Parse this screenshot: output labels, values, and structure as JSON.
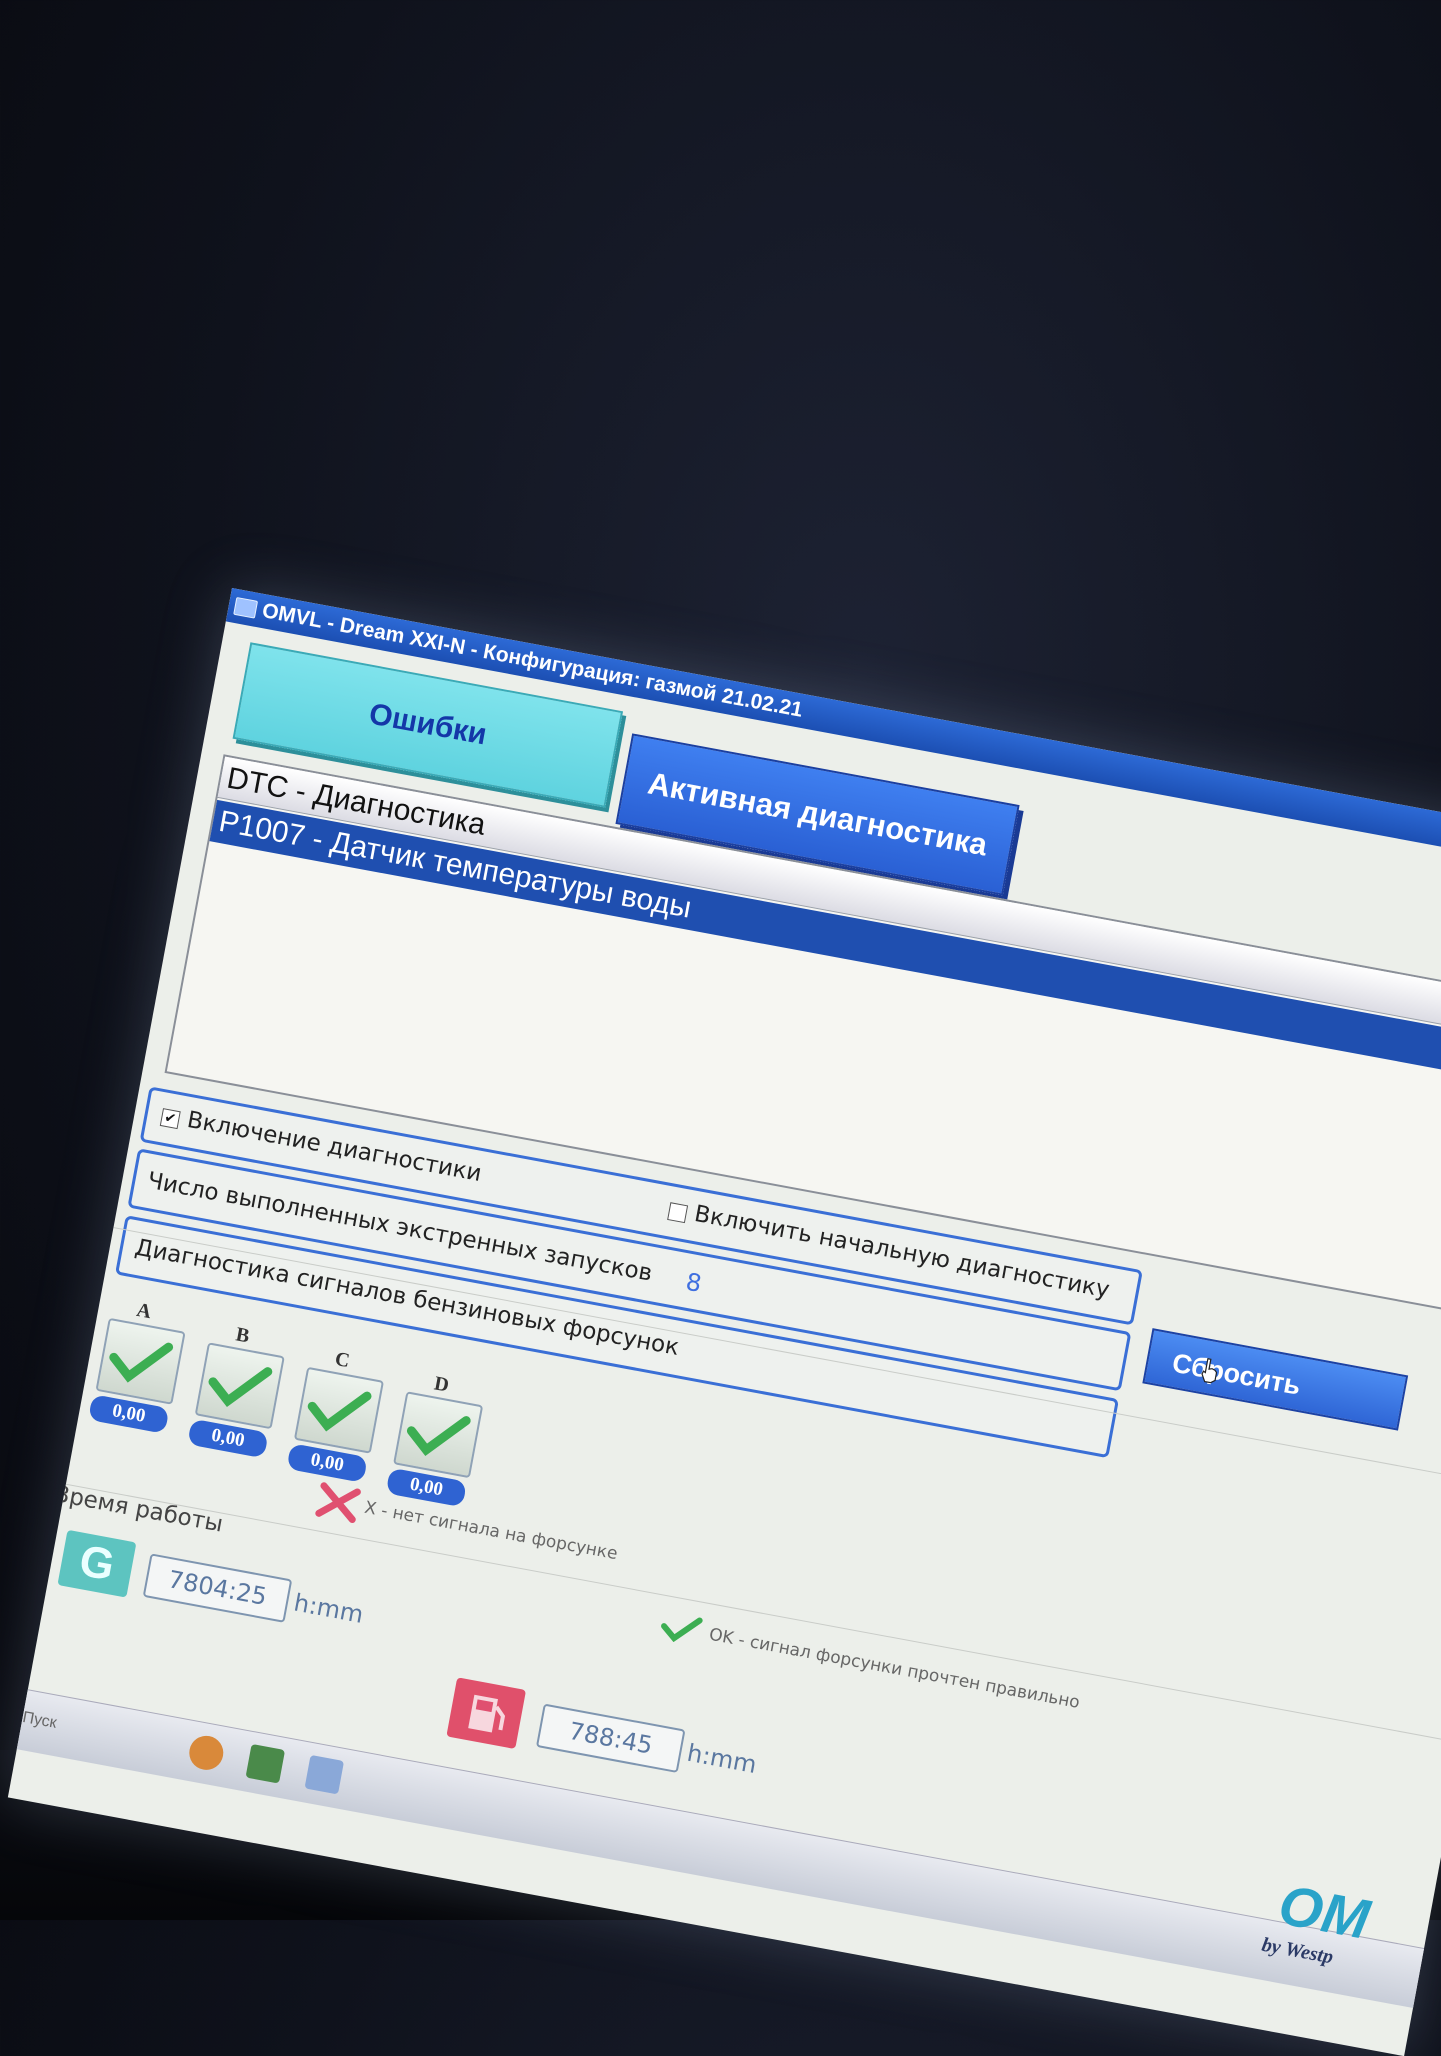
{
  "window": {
    "title": "OMVL - Dream XXI-N - Конфигурация: газмой 21.02.21"
  },
  "tabs": {
    "errors": "Ошибки",
    "active_diagnostics": "Активная диагностика"
  },
  "dtc_list": {
    "header": "DTC - Диагностика",
    "rows": [
      "P1007 - Датчик температуры воды"
    ]
  },
  "options": {
    "enable_diagnostics": {
      "label": "Включение диагностики",
      "checked": true
    },
    "enable_initial_diagnostics": {
      "label": "Включить начальную диагностику",
      "checked": false
    }
  },
  "emergency_starts": {
    "label": "Число выполненных экстренных запусков",
    "value": "8",
    "reset_label": "Сбросить"
  },
  "injectors": {
    "title": "Диагностика сигналов бензиновых форсунок",
    "items": [
      {
        "letter": "A",
        "value": "0,00",
        "status": "ok"
      },
      {
        "letter": "B",
        "value": "0,00",
        "status": "ok"
      },
      {
        "letter": "C",
        "value": "0,00",
        "status": "ok"
      },
      {
        "letter": "D",
        "value": "0,00",
        "status": "ok"
      }
    ],
    "legend_fail": "X - нет сигнала на форсунке",
    "legend_ok": "OK - сигнал форсунки прочтен правильно"
  },
  "runtime": {
    "title": "Время работы",
    "gas_time": "7804:25",
    "petrol_time": "788:45",
    "unit": "h:mm"
  },
  "taskbar": {
    "start_label": "Пуск"
  },
  "brand": {
    "name": "OM",
    "sub": "by Westp"
  },
  "colors": {
    "title_bar": "#1f55c0",
    "tab_errors": "#66d8e2",
    "tab_active": "#3470e2",
    "selection": "#1f4fb0",
    "ok_check": "#3cae52",
    "fail_x": "#e05070"
  }
}
